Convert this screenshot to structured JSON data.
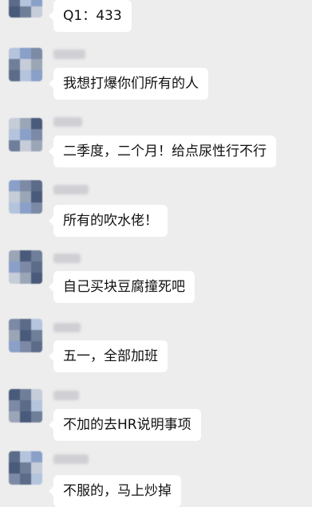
{
  "colors": {
    "background": "#ededed",
    "bubble": "#ffffff",
    "text": "#111111",
    "avatar_palette": [
      "#6f7f9a",
      "#8aa0c8",
      "#4a5a7a",
      "#b4c4dc",
      "#9aa6b6",
      "#5c6c88",
      "#c6ccd8",
      "#7c8aa6"
    ]
  },
  "messages": [
    {
      "text": "Q1：433",
      "avatar": "blurred-avatar",
      "sender": "blurred-name"
    },
    {
      "text": "我想打爆你们所有的人",
      "avatar": "blurred-avatar",
      "sender": "blurred-name"
    },
    {
      "text": "二季度，二个月！给点尿性行不行",
      "avatar": "blurred-avatar",
      "sender": "blurred-name"
    },
    {
      "text": "所有的吹水佬！",
      "avatar": "blurred-avatar",
      "sender": "blurred-name"
    },
    {
      "text": "自己买块豆腐撞死吧",
      "avatar": "blurred-avatar",
      "sender": "blurred-name"
    },
    {
      "text": "五一，全部加班",
      "avatar": "blurred-avatar",
      "sender": "blurred-name"
    },
    {
      "text": "不加的去HR说明事项",
      "avatar": "blurred-avatar",
      "sender": "blurred-name"
    },
    {
      "text": "不服的，马上炒掉",
      "avatar": "blurred-avatar",
      "sender": "blurred-name"
    }
  ]
}
